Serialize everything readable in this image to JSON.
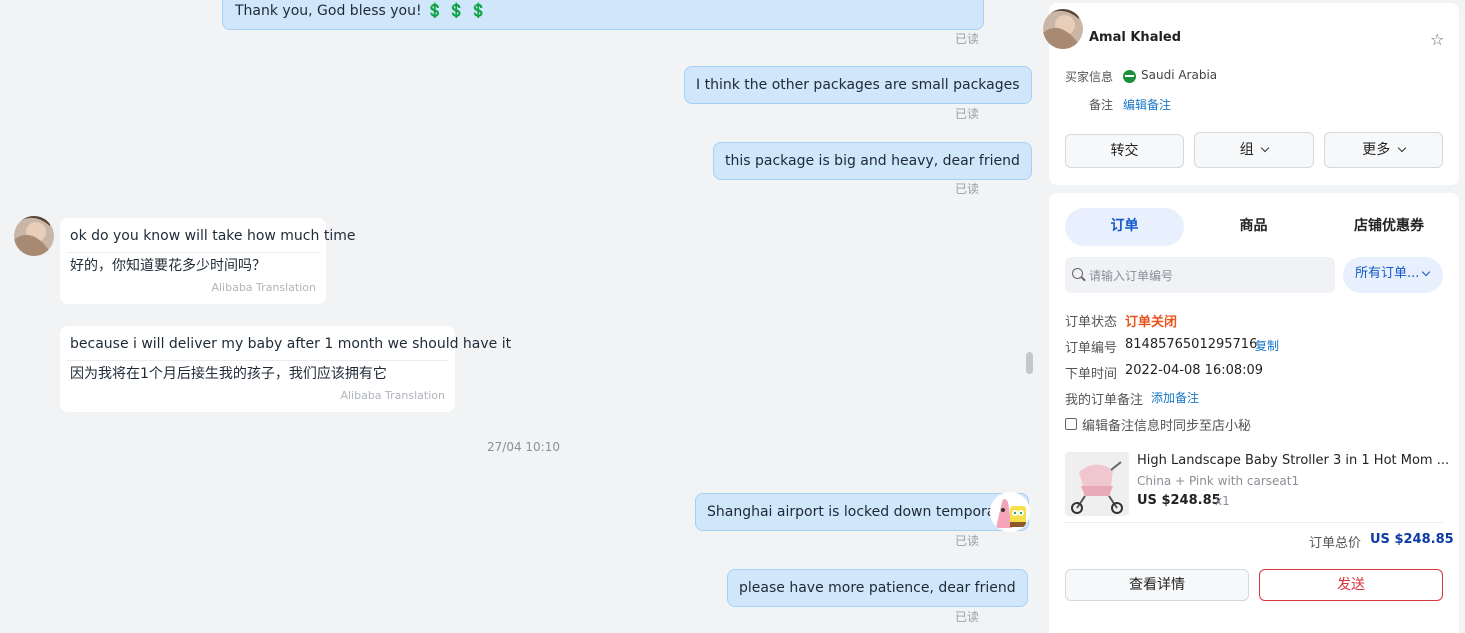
{
  "chat": {
    "messages": [
      {
        "text": "Thank you, God bless you! 💲 💲 💲",
        "status": "已读"
      },
      {
        "text": "I think the other packages are small packages",
        "status": "已读"
      },
      {
        "text": "this package is big and heavy, dear friend",
        "status": "已读"
      },
      {
        "text": "ok do you know will take how much time",
        "translation": "好的，你知道要花多少时间吗？",
        "translator": "Alibaba Translation"
      },
      {
        "text": "because i will deliver my baby after 1 month we should have it",
        "translation": "因为我将在1个月后接生我的孩子，我们应该拥有它",
        "translator": "Alibaba Translation"
      },
      {
        "text": "Shanghai airport is locked down temporarily",
        "status": "已读"
      },
      {
        "text": "please have more patience, dear friend",
        "status": "已读"
      }
    ],
    "time_separator": "27/04 10:10"
  },
  "customer": {
    "name": "Amal Khaled",
    "buyer_info_label": "买家信息",
    "country": "Saudi Arabia",
    "note_label": "备注",
    "edit_note": "编辑备注",
    "buttons": {
      "transfer": "转交",
      "group": "组",
      "more": "更多"
    }
  },
  "orders": {
    "tabs": [
      "订单",
      "商品",
      "店铺优惠券"
    ],
    "search_placeholder": "请输入订单编号",
    "filter": "所有订单...",
    "status_label": "订单状态",
    "status_value": "订单关闭",
    "order_no_label": "订单编号",
    "order_no": "8148576501295716",
    "copy": "复制",
    "order_time_label": "下单时间",
    "order_time": "2022-04-08 16:08:09",
    "my_note_label": "我的订单备注",
    "add_note": "添加备注",
    "sync_label": "编辑备注信息时同步至店小秘",
    "product": {
      "title": "High Landscape Baby Stroller 3 in 1 Hot Mom ...",
      "variant": "China + Pink with carseat1",
      "price": "US $248.85",
      "qty": "x1"
    },
    "total_label": "订单总价",
    "total": "US $248.85",
    "view_details": "查看详情",
    "send": "发送"
  },
  "colors": {
    "bubble_out": "#cfe6fb",
    "accent_blue": "#1677c9",
    "status_red": "#e8541c",
    "total_blue": "#0b3aa8",
    "send_red": "#d9363e"
  }
}
